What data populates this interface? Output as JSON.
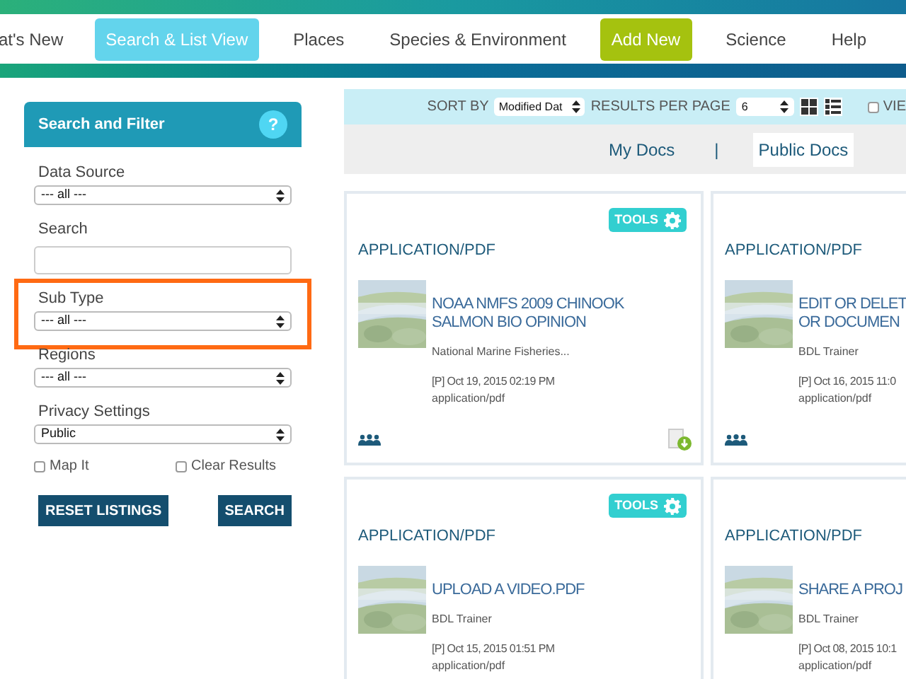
{
  "nav": [
    {
      "label": "at's New",
      "kind": "link",
      "selected": false
    },
    {
      "label": "Search & List View",
      "kind": "link",
      "selected": true
    },
    {
      "label": "Places",
      "kind": "link",
      "selected": false
    },
    {
      "label": "Species & Environment",
      "kind": "link",
      "selected": false
    },
    {
      "label": "Add New",
      "kind": "action",
      "selected": false
    },
    {
      "label": "Science",
      "kind": "link",
      "selected": false
    },
    {
      "label": "Help",
      "kind": "link",
      "selected": false
    }
  ],
  "sidebar": {
    "title": "Search and Filter",
    "help": "?",
    "fields": [
      {
        "label": "Data Source",
        "kind": "select",
        "value": "--- all ---",
        "highlighted": false
      },
      {
        "label": "Search",
        "kind": "text",
        "highlighted": false
      },
      {
        "label": "Sub Type",
        "kind": "select",
        "value": "--- all ---",
        "highlighted": true
      },
      {
        "label": "Regions",
        "kind": "select",
        "value": "--- all ---",
        "highlighted": false
      },
      {
        "label": "Privacy Settings",
        "kind": "select",
        "value": "Public",
        "highlighted": false
      }
    ],
    "checkboxes": [
      {
        "label": "Map It",
        "checked": false
      },
      {
        "label": "Clear Results",
        "checked": false
      }
    ],
    "buttons": [
      "RESET LISTINGS",
      "SEARCH"
    ]
  },
  "toolbar": {
    "sort_label": "SORT BY",
    "sort_value": "Modified Dat",
    "per_page_label": "RESULTS PER PAGE",
    "per_page_value": "6",
    "grid_view": true,
    "view_checkbox": {
      "label": "VIE",
      "checked": false
    }
  },
  "doc_tabs": [
    {
      "label": "My Docs",
      "selected": false
    },
    {
      "label": "|",
      "kind": "separator"
    },
    {
      "label": "Public Docs",
      "selected": true
    }
  ],
  "cards": [
    {
      "tools": "TOOLS",
      "type": "APPLICATION/PDF",
      "title_lines": [
        "NOAA NMFS 2009 CHINOOK",
        "SALMON BIO OPINION"
      ],
      "author": "National Marine Fisheries...",
      "date": "[P] Oct 19, 2015 02:19 PM",
      "mime": "application/pdf",
      "download": true
    },
    {
      "type": "APPLICATION/PDF",
      "title_lines": [
        "EDIT OR DELET",
        "OR DOCUMEN"
      ],
      "author": "BDL Trainer",
      "date": "[P] Oct 16, 2015 11:0",
      "mime": "application/pdf",
      "download": false
    },
    {
      "tools": "TOOLS",
      "type": "APPLICATION/PDF",
      "title_lines": [
        "UPLOAD A VIDEO.PDF"
      ],
      "author": "BDL Trainer",
      "date": "[P] Oct 15, 2015 01:51 PM",
      "mime": "application/pdf",
      "download": false
    },
    {
      "type": "APPLICATION/PDF",
      "title_lines": [
        "SHARE A PROJ"
      ],
      "author": "BDL Trainer",
      "date": "[P] Oct 08, 2015 10:1",
      "mime": "application/pdf",
      "download": false
    }
  ]
}
